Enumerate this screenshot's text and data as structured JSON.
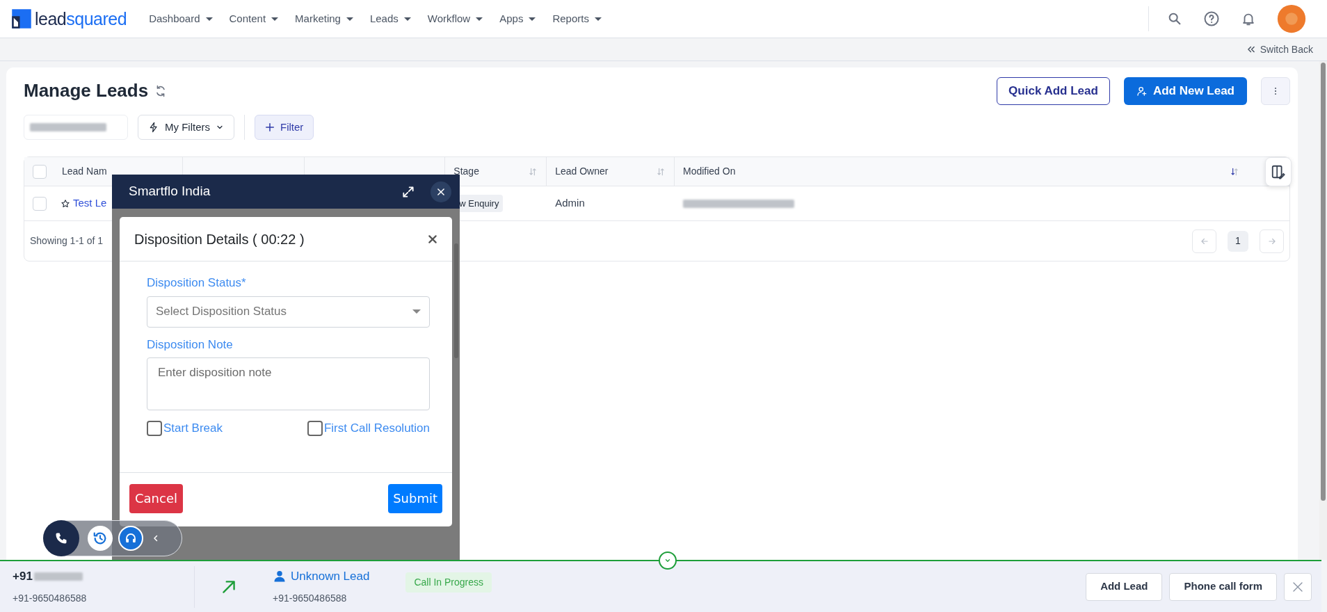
{
  "brand": {
    "part_a": "lead",
    "part_b": "squared"
  },
  "nav": [
    {
      "label": "Dashboard"
    },
    {
      "label": "Content"
    },
    {
      "label": "Marketing"
    },
    {
      "label": "Leads"
    },
    {
      "label": "Workflow"
    },
    {
      "label": "Apps"
    },
    {
      "label": "Reports"
    }
  ],
  "subbar": {
    "link": "Switch Back"
  },
  "page": {
    "title": "Manage Leads",
    "quick_add": "Quick Add Lead",
    "add_new": "Add New Lead"
  },
  "filters": {
    "my_filters": "My Filters",
    "filter": "Filter"
  },
  "table": {
    "header_checked": false,
    "columns": [
      {
        "label": "Lead Nam"
      },
      {
        "label": "Stage"
      },
      {
        "label": "Lead Owner"
      },
      {
        "label": "Modified On"
      }
    ],
    "rows": [
      {
        "checked": false,
        "lead_name": "Test Le",
        "stage": "w Enquiry",
        "owner": "Admin"
      }
    ],
    "footer": "Showing 1-1 of 1",
    "page": "1"
  },
  "dialer": {
    "title": "Smartflo India"
  },
  "disposition": {
    "title": "Disposition Details ( 00:22 )",
    "status_label": "Disposition Status*",
    "status_placeholder": "Select Disposition Status",
    "note_label": "Disposition Note",
    "note_placeholder": "Enter disposition note",
    "checks": [
      {
        "label": "Start Break",
        "checked": false
      },
      {
        "label": "First Call Resolution",
        "checked": false
      }
    ],
    "cancel": "Cancel",
    "submit": "Submit"
  },
  "call_bar": {
    "number_prefix": "+91",
    "number": "+91-9650486588",
    "lead": "Unknown Lead",
    "lead_number": "+91-9650486588",
    "status": "Call In Progress",
    "buttons": [
      "Add Lead",
      "Phone call form"
    ]
  }
}
